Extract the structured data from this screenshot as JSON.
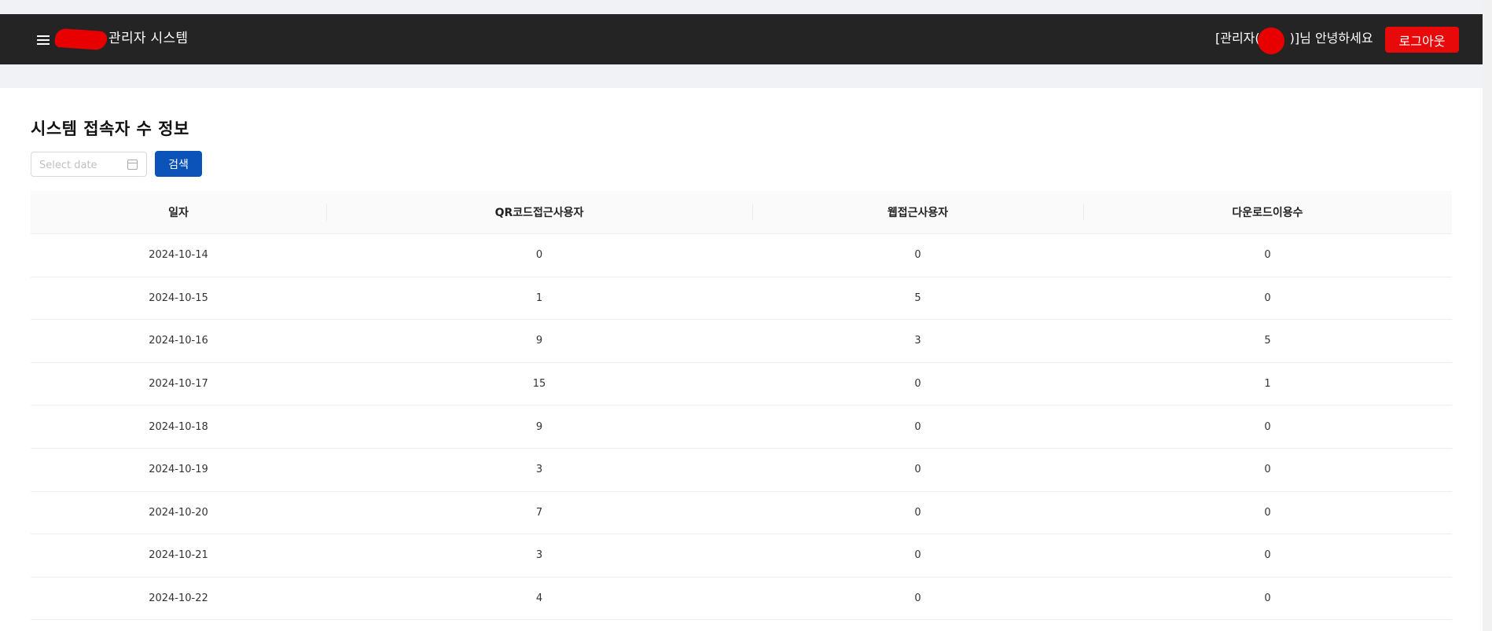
{
  "header": {
    "app_title": "관리자 시스템",
    "greeting_prefix": "[관리자(",
    "greeting_suffix": ")]님 안녕하세요",
    "logout_label": "로그아웃"
  },
  "main": {
    "title": "시스템 접속자 수 정보",
    "date_placeholder": "Select date",
    "search_label": "검색"
  },
  "table": {
    "columns": [
      "일자",
      "QR코드접근사용자",
      "웹접근사용자",
      "다운로드이용수"
    ],
    "rows": [
      [
        "2024-10-14",
        "0",
        "0",
        "0"
      ],
      [
        "2024-10-15",
        "1",
        "5",
        "0"
      ],
      [
        "2024-10-16",
        "9",
        "3",
        "5"
      ],
      [
        "2024-10-17",
        "15",
        "0",
        "1"
      ],
      [
        "2024-10-18",
        "9",
        "0",
        "0"
      ],
      [
        "2024-10-19",
        "3",
        "0",
        "0"
      ],
      [
        "2024-10-20",
        "7",
        "0",
        "0"
      ],
      [
        "2024-10-21",
        "3",
        "0",
        "0"
      ],
      [
        "2024-10-22",
        "4",
        "0",
        "0"
      ]
    ]
  },
  "colors": {
    "header_bg": "#242424",
    "logout_bg": "#e80a0a",
    "search_bg": "#0b53b8"
  },
  "icons": [
    "hamburger-menu-icon",
    "calendar-icon"
  ]
}
